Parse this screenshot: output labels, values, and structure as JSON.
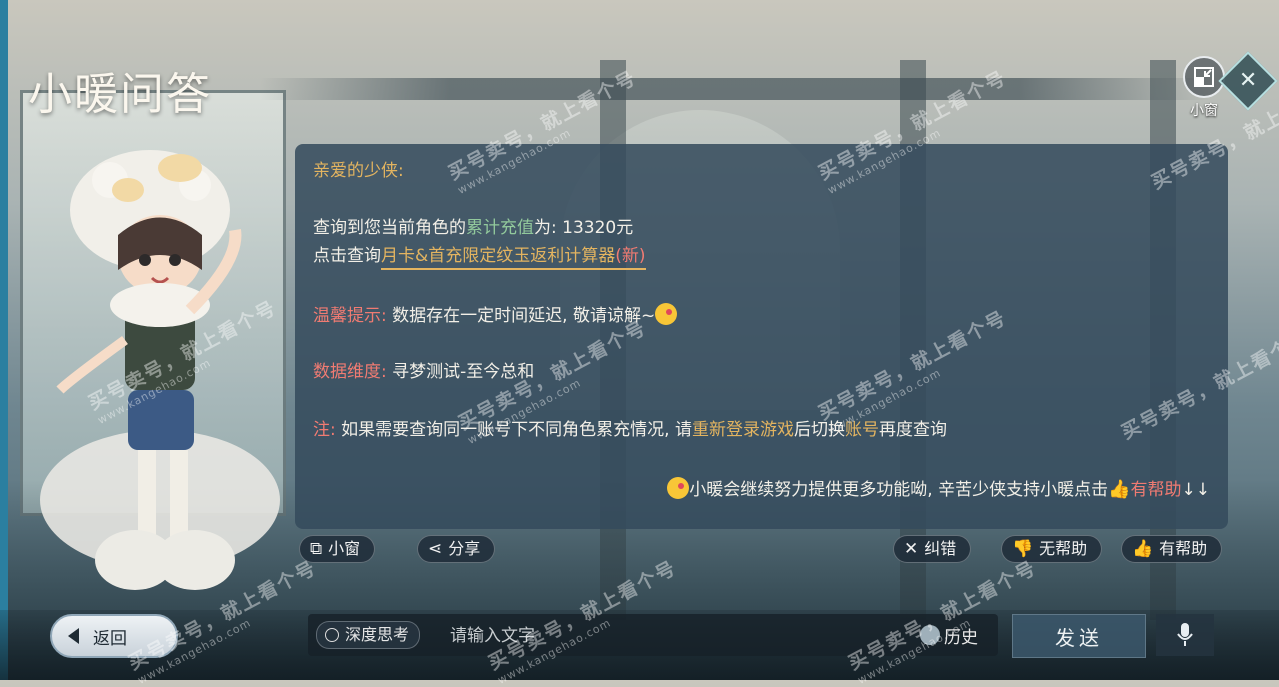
{
  "app": {
    "title": "小暖问答"
  },
  "top_controls": {
    "mini_window_label": "小窗"
  },
  "message": {
    "greeting": "亲爱的少侠:",
    "query_prefix": "查询到您当前角色的",
    "query_keyword": "累计充值",
    "query_suffix": "为: 13320元",
    "link_prefix": "点击查询",
    "link_text": "月卡&首充限定纹玉返利计算器",
    "link_badge": "(新)",
    "tip_label": "温馨提示:",
    "tip_text": "数据存在一定时间延迟, 敬请谅解~",
    "dimension_label": "数据维度:",
    "dimension_text": "寻梦测试-至今总和",
    "note_label": "注:",
    "note_text_a": "如果需要查询同一账号下不同角色累充情况, 请",
    "note_highlight_a": "重新登录游戏",
    "note_text_b": "后切换",
    "note_highlight_b": "账号",
    "note_text_c": "再度查询",
    "closing_text": "小暖会继续努力提供更多功能呦, 辛苦少侠支持小暖点击",
    "closing_highlight": "有帮助",
    "closing_arrows": "↓↓"
  },
  "actions": {
    "mini_window": "小窗",
    "share": "分享",
    "correct": "纠错",
    "not_helpful": "无帮助",
    "helpful": "有帮助"
  },
  "bottom": {
    "back": "返回",
    "deep_think": "深度思考",
    "input_placeholder": "请输入文字",
    "history": "历史",
    "send": "发送"
  },
  "watermark": {
    "text": "买号卖号，就上看个号",
    "url": "www.kangehao.com"
  },
  "colors": {
    "panel_bg": "#344a5c",
    "highlight_gold": "#e3b460",
    "highlight_red": "#f07b72",
    "highlight_green": "#92c99c"
  }
}
